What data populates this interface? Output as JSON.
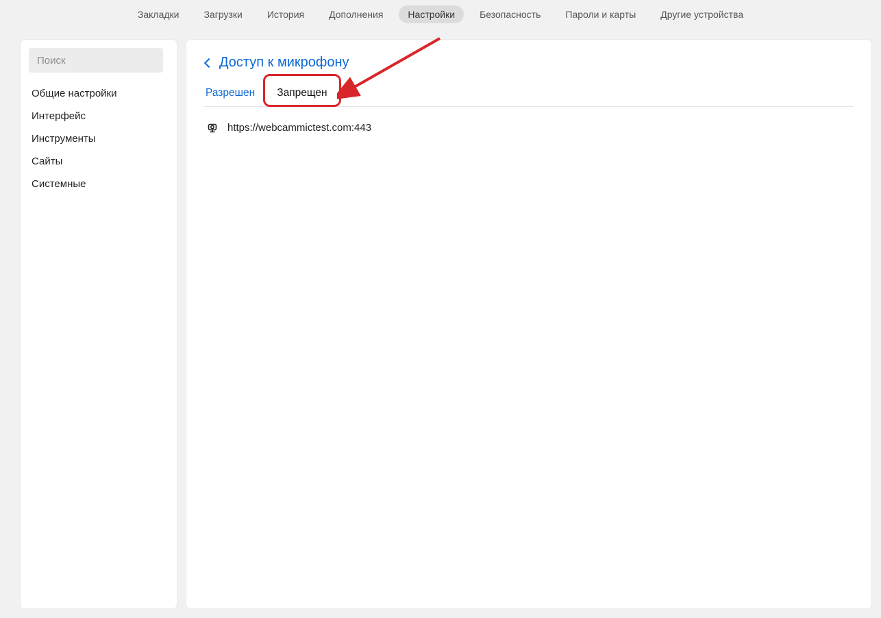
{
  "topnav": {
    "items": [
      {
        "label": "Закладки"
      },
      {
        "label": "Загрузки"
      },
      {
        "label": "История"
      },
      {
        "label": "Дополнения"
      },
      {
        "label": "Настройки",
        "active": true
      },
      {
        "label": "Безопасность"
      },
      {
        "label": "Пароли и карты"
      },
      {
        "label": "Другие устройства"
      }
    ]
  },
  "sidebar": {
    "search_placeholder": "Поиск",
    "items": [
      {
        "label": "Общие настройки"
      },
      {
        "label": "Интерфейс"
      },
      {
        "label": "Инструменты"
      },
      {
        "label": "Сайты"
      },
      {
        "label": "Системные"
      }
    ]
  },
  "main": {
    "title": "Доступ к микрофону",
    "tabs": {
      "allowed": "Разрешен",
      "denied": "Запрещен"
    },
    "sites": [
      {
        "url": "https://webcammictest.com:443"
      }
    ]
  }
}
